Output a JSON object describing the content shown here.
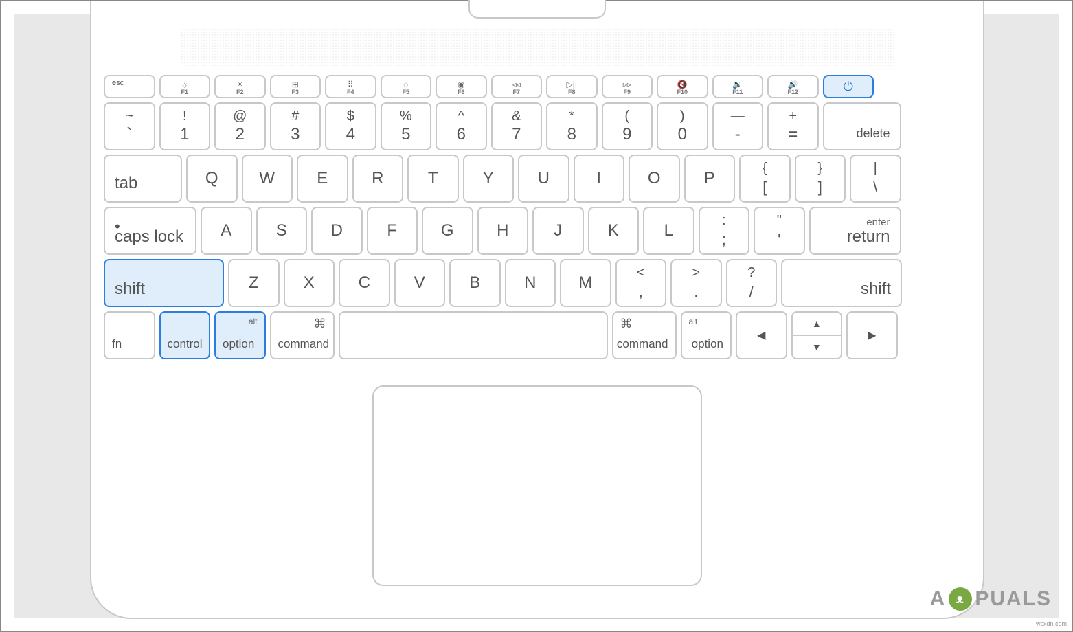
{
  "fn_row": {
    "esc": "esc",
    "keys": [
      {
        "icon": "☼",
        "label": "F1"
      },
      {
        "icon": "☀",
        "label": "F2"
      },
      {
        "icon": "⊞",
        "label": "F3"
      },
      {
        "icon": "⠿",
        "label": "F4"
      },
      {
        "icon": "◌",
        "label": "F5"
      },
      {
        "icon": "◉",
        "label": "F6"
      },
      {
        "icon": "◃◃",
        "label": "F7"
      },
      {
        "icon": "▷||",
        "label": "F8"
      },
      {
        "icon": "▹▹",
        "label": "F9"
      },
      {
        "icon": "🔇",
        "label": "F10"
      },
      {
        "icon": "🔉",
        "label": "F11"
      },
      {
        "icon": "🔊",
        "label": "F12"
      }
    ],
    "power_icon": "⏻"
  },
  "num_row": {
    "keys": [
      {
        "top": "~",
        "bot": "`"
      },
      {
        "top": "!",
        "bot": "1"
      },
      {
        "top": "@",
        "bot": "2"
      },
      {
        "top": "#",
        "bot": "3"
      },
      {
        "top": "$",
        "bot": "4"
      },
      {
        "top": "%",
        "bot": "5"
      },
      {
        "top": "^",
        "bot": "6"
      },
      {
        "top": "&",
        "bot": "7"
      },
      {
        "top": "*",
        "bot": "8"
      },
      {
        "top": "(",
        "bot": "9"
      },
      {
        "top": ")",
        "bot": "0"
      },
      {
        "top": "—",
        "bot": "-"
      },
      {
        "top": "+",
        "bot": "="
      }
    ],
    "delete": "delete"
  },
  "qwerty_row": {
    "tab": "tab",
    "letters": [
      "Q",
      "W",
      "E",
      "R",
      "T",
      "Y",
      "U",
      "I",
      "O",
      "P"
    ],
    "brackets": [
      {
        "top": "{",
        "bot": "["
      },
      {
        "top": "}",
        "bot": "]"
      },
      {
        "top": "|",
        "bot": "\\"
      }
    ]
  },
  "home_row": {
    "caps": "caps lock",
    "letters": [
      "A",
      "S",
      "D",
      "F",
      "G",
      "H",
      "J",
      "K",
      "L"
    ],
    "punct": [
      {
        "top": ":",
        "bot": ";"
      },
      {
        "top": "\"",
        "bot": "'"
      }
    ],
    "enter_top": "enter",
    "enter": "return"
  },
  "zxc_row": {
    "shift_l": "shift",
    "letters": [
      "Z",
      "X",
      "C",
      "V",
      "B",
      "N",
      "M"
    ],
    "punct": [
      {
        "top": "<",
        "bot": ","
      },
      {
        "top": ">",
        "bot": "."
      },
      {
        "top": "?",
        "bot": "/"
      }
    ],
    "shift_r": "shift"
  },
  "bottom_row": {
    "fn": "fn",
    "control": "control",
    "option_l_top": "alt",
    "option_l": "option",
    "command_l_icon": "⌘",
    "command_l": "command",
    "command_r_icon": "⌘",
    "command_r": "command",
    "option_r_top": "alt",
    "option_r": "option",
    "arrows": {
      "left": "◀",
      "up": "▲",
      "down": "▼",
      "right": "▶"
    }
  },
  "highlighted_keys": [
    "power",
    "shift_l",
    "control",
    "option_l"
  ],
  "watermark": {
    "prefix": "A",
    "suffix": "PUALS"
  },
  "credit": "wsxdn.com"
}
